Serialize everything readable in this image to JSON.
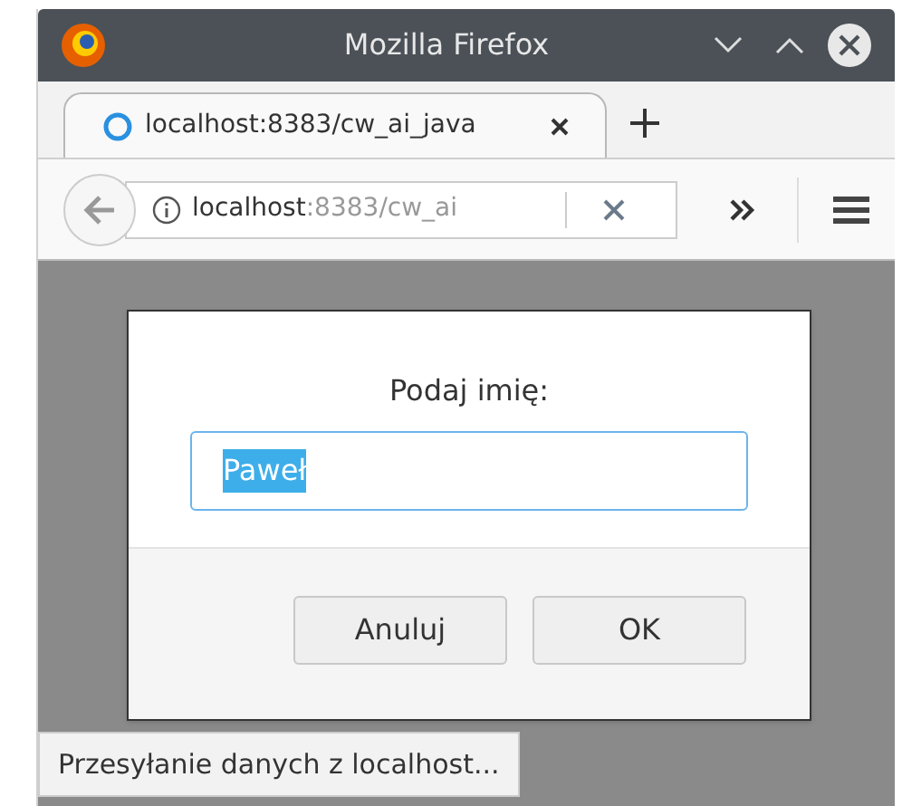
{
  "window": {
    "title": "Mozilla Firefox"
  },
  "tabs": [
    {
      "label": "localhost:8383/cw_ai_java",
      "selected": true
    }
  ],
  "url": {
    "host": "localhost",
    "rest": ":8383/cw_ai"
  },
  "dialog": {
    "prompt": "Podaj imię:",
    "value": "Paweł",
    "value_selected": true,
    "buttons": [
      "Anuluj",
      "OK"
    ]
  },
  "status_bar": "Przesyłanie danych z localhost..."
}
